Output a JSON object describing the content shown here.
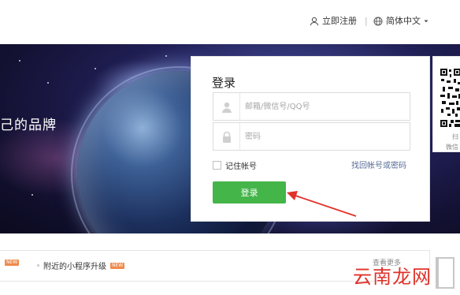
{
  "header": {
    "register_label": "立即注册",
    "language_label": "简体中文"
  },
  "banner": {
    "slogan": "己的品牌"
  },
  "login": {
    "title": "登录",
    "account_placeholder": "邮箱/微信号/QQ号",
    "password_placeholder": "密码",
    "remember_label": "记住帐号",
    "forgot_label": "找回帐号或密码",
    "submit_label": "登录"
  },
  "qr": {
    "caption_line1": "扫",
    "caption_line2": "微信"
  },
  "news": {
    "item_1_badge": "NEW",
    "item_2_label": "附近的小程序升级",
    "item_2_badge": "NEW",
    "more_label": "查看更多"
  },
  "watermark": {
    "text": "云南龙网"
  },
  "colors": {
    "primary_button": "#44b549",
    "link": "#576b95",
    "badge": "#f08a4b",
    "arrow": "#e0322a",
    "watermark": "#e0322a"
  },
  "icons": {
    "register": "user-icon",
    "language": "globe-icon",
    "language_dropdown": "caret-down-icon",
    "account_field": "user-icon",
    "password_field": "lock-icon"
  }
}
